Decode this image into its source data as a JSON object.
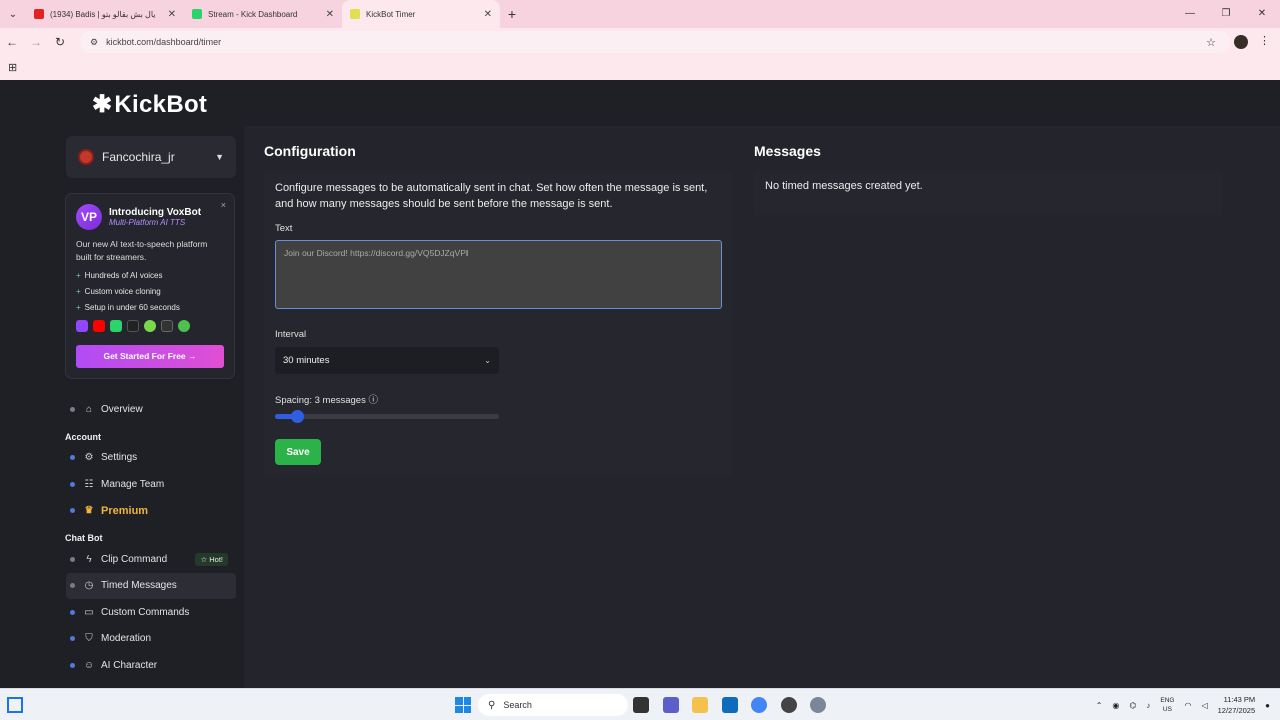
{
  "browser": {
    "tabs": [
      {
        "title": "(1934) Badis | يال بش بقالو بتو",
        "favicon_color": "#e32222"
      },
      {
        "title": "Stream - Kick Dashboard",
        "favicon_color": "#2bd46b"
      },
      {
        "title": "KickBot Timer",
        "favicon_color": "#e0e050"
      }
    ],
    "url": "kickbot.com/dashboard/timer"
  },
  "app": {
    "logo": "KickBot",
    "user": {
      "name": "Fancochira_jr"
    },
    "promo": {
      "title": "Introducing VoxBot",
      "subtitle": "Multi-Platform AI TTS",
      "logo_text": "VP",
      "description": "Our new AI text-to-speech platform built for streamers.",
      "features": [
        "Hundreds of AI voices",
        "Custom voice cloning",
        "Setup in under 60 seconds"
      ],
      "cta": "Get Started For Free →",
      "close": "×"
    },
    "nav": {
      "overview": "Overview",
      "account_label": "Account",
      "settings": "Settings",
      "manage_team": "Manage Team",
      "premium": "Premium",
      "chatbot_label": "Chat Bot",
      "clip_command": "Clip Command",
      "hot_badge": "☆ Hot!",
      "timed_messages": "Timed Messages",
      "custom_commands": "Custom Commands",
      "moderation": "Moderation",
      "ai_character": "AI Character"
    },
    "config": {
      "title": "Configuration",
      "description": "Configure messages to be automatically sent in chat. Set how often the message is sent, and how many messages should be sent before the message is sent.",
      "text_label": "Text",
      "text_value": "Join our Discord! https://discord.gg/VQ5DJZqVP",
      "interval_label": "Interval",
      "interval_value": "30 minutes",
      "spacing_label": "Spacing: 3 messages ⓘ",
      "spacing_fraction": 0.1,
      "save": "Save"
    },
    "messages": {
      "title": "Messages",
      "empty": "No timed messages created yet."
    }
  },
  "taskbar": {
    "search": "Search",
    "lang_1": "ENG",
    "lang_2": "US",
    "time": "11:43 PM",
    "date": "12/27/2025"
  }
}
